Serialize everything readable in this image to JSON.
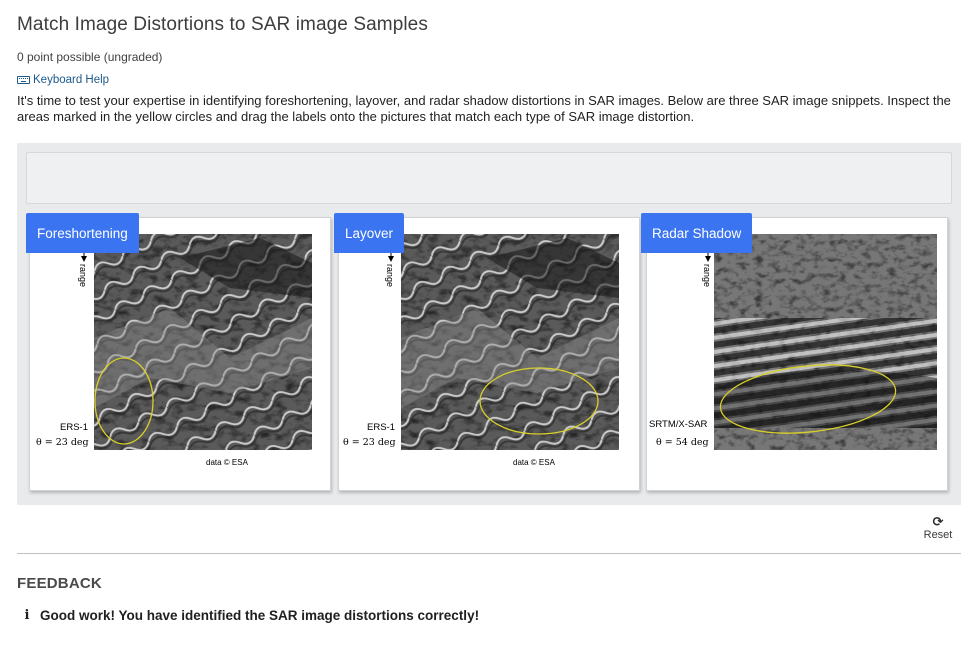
{
  "problem": {
    "title": "Match Image Distortions to SAR image Samples",
    "points": "0 point possible (ungraded)",
    "keyboard_help": "Keyboard Help",
    "description": "It's time to test your expertise in identifying foreshortening, layover, and radar shadow distortions in SAR images. Below are three SAR image snippets. Inspect the areas marked in the yellow circles and drag the labels onto the pictures that match each type of SAR image distortion."
  },
  "targets": [
    {
      "label": "Foreshortening",
      "range_text": "range",
      "sensor": "ERS-1",
      "angle": "θ = 23 deg",
      "credit": "data © ESA"
    },
    {
      "label": "Layover",
      "range_text": "range",
      "sensor": "ERS-1",
      "angle": "θ = 23 deg",
      "credit": "data © ESA"
    },
    {
      "label": "Radar Shadow",
      "range_text": "range",
      "sensor": "SRTM/X-SAR",
      "angle": "θ = 54 deg",
      "credit": ""
    }
  ],
  "reset_label": "Reset",
  "feedback": {
    "title": "FEEDBACK",
    "message": "Good work! You have identified the SAR image distortions correctly!"
  },
  "colors": {
    "label_bg": "#3b74f0",
    "highlight_circle": "#d9cf2a"
  },
  "icons": {
    "keyboard": "keyboard-icon",
    "reset": "refresh-icon",
    "info": "info-icon"
  }
}
